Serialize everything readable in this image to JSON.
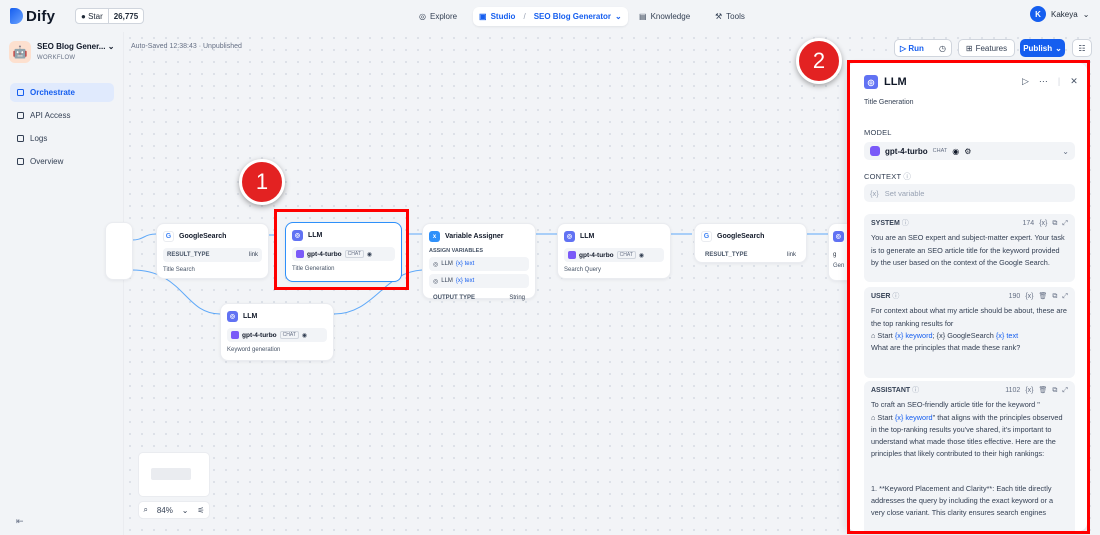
{
  "header": {
    "logo_text": "Dify",
    "github_star_label": "Star",
    "github_star_count": "26,775",
    "nav": {
      "explore": "Explore",
      "studio": "Studio",
      "breadcrumb_app": "SEO Blog Generator",
      "knowledge": "Knowledge",
      "tools": "Tools"
    },
    "user": {
      "initial": "K",
      "name": "Kakeya"
    }
  },
  "sidebar": {
    "app_name": "SEO Blog Gener...",
    "app_type": "WORKFLOW",
    "items": [
      {
        "label": "Orchestrate",
        "active": true
      },
      {
        "label": "API Access",
        "active": false
      },
      {
        "label": "Logs",
        "active": false
      },
      {
        "label": "Overview",
        "active": false
      }
    ]
  },
  "toolbar": {
    "autosave": "Auto-Saved 12:38:43 · Unpublished",
    "run_label": "Run",
    "features_label": "Features",
    "publish_label": "Publish"
  },
  "nodes": {
    "google_search_1": {
      "title": "GoogleSearch",
      "result_type_key": "RESULT_TYPE",
      "result_type_val": "link",
      "desc": "Title Search"
    },
    "llm_title": {
      "title": "LLM",
      "model": "gpt-4-turbo",
      "mode": "CHAT",
      "desc": "Title Generation"
    },
    "variable_assigner": {
      "title": "Variable Assigner",
      "assign_label": "ASSIGN VARIABLES",
      "var1": "LLM",
      "var1_ref": "{x} text",
      "var2": "LLM",
      "var2_ref": "{x} text",
      "output_label": "OUTPUT TYPE",
      "output_val": "String"
    },
    "llm_query": {
      "title": "LLM",
      "model": "gpt-4-turbo",
      "mode": "CHAT",
      "desc": "Search Query"
    },
    "google_search_2": {
      "title": "GoogleSearch",
      "result_type_key": "RESULT_TYPE",
      "result_type_val": "link"
    },
    "llm_keyword": {
      "title": "LLM",
      "model": "gpt-4-turbo",
      "mode": "CHAT",
      "desc": "Keyword generation"
    },
    "llm_partial": {
      "title": "L",
      "model": "g",
      "desc": "Gen"
    }
  },
  "annotations": {
    "badge1": "1",
    "badge2": "2"
  },
  "zoom": {
    "level": "84%"
  },
  "panel": {
    "title": "LLM",
    "description": "Title Generation",
    "model_label": "MODEL",
    "model_name": "gpt-4-turbo",
    "model_mode": "CHAT",
    "context_label": "CONTEXT",
    "context_placeholder": "Set variable",
    "system": {
      "role": "SYSTEM",
      "count": "174",
      "text": "You are an SEO expert and subject-matter expert. Your task is to generate an SEO article title for the keyword provided by the user based on the context of the Google Search."
    },
    "user": {
      "role": "USER",
      "count": "190",
      "line1": "For context about what my article should be about, these are the top ranking results for",
      "ref_start": "Start",
      "ref_keyword": "{x} keyword",
      "ref_google": "{x} GoogleSearch",
      "ref_text": "{x} text",
      "line2": "What are the principles that made these rank?"
    },
    "assistant": {
      "role": "ASSISTANT",
      "count": "1102",
      "line_a": "To craft an SEO-friendly article title for the keyword \"",
      "ref_start": "Start",
      "ref_keyword": "{x} keyword",
      "line_b": "\" that aligns with the principles observed in the top-ranking results you've shared, it's important to understand what made those titles effective. Here are the principles that likely contributed to their high rankings:",
      "line_c": "1. **Keyword Placement and Clarity**: Each title directly addresses the query by including the exact keyword or a very close variant. This clarity ensures search engines"
    }
  }
}
